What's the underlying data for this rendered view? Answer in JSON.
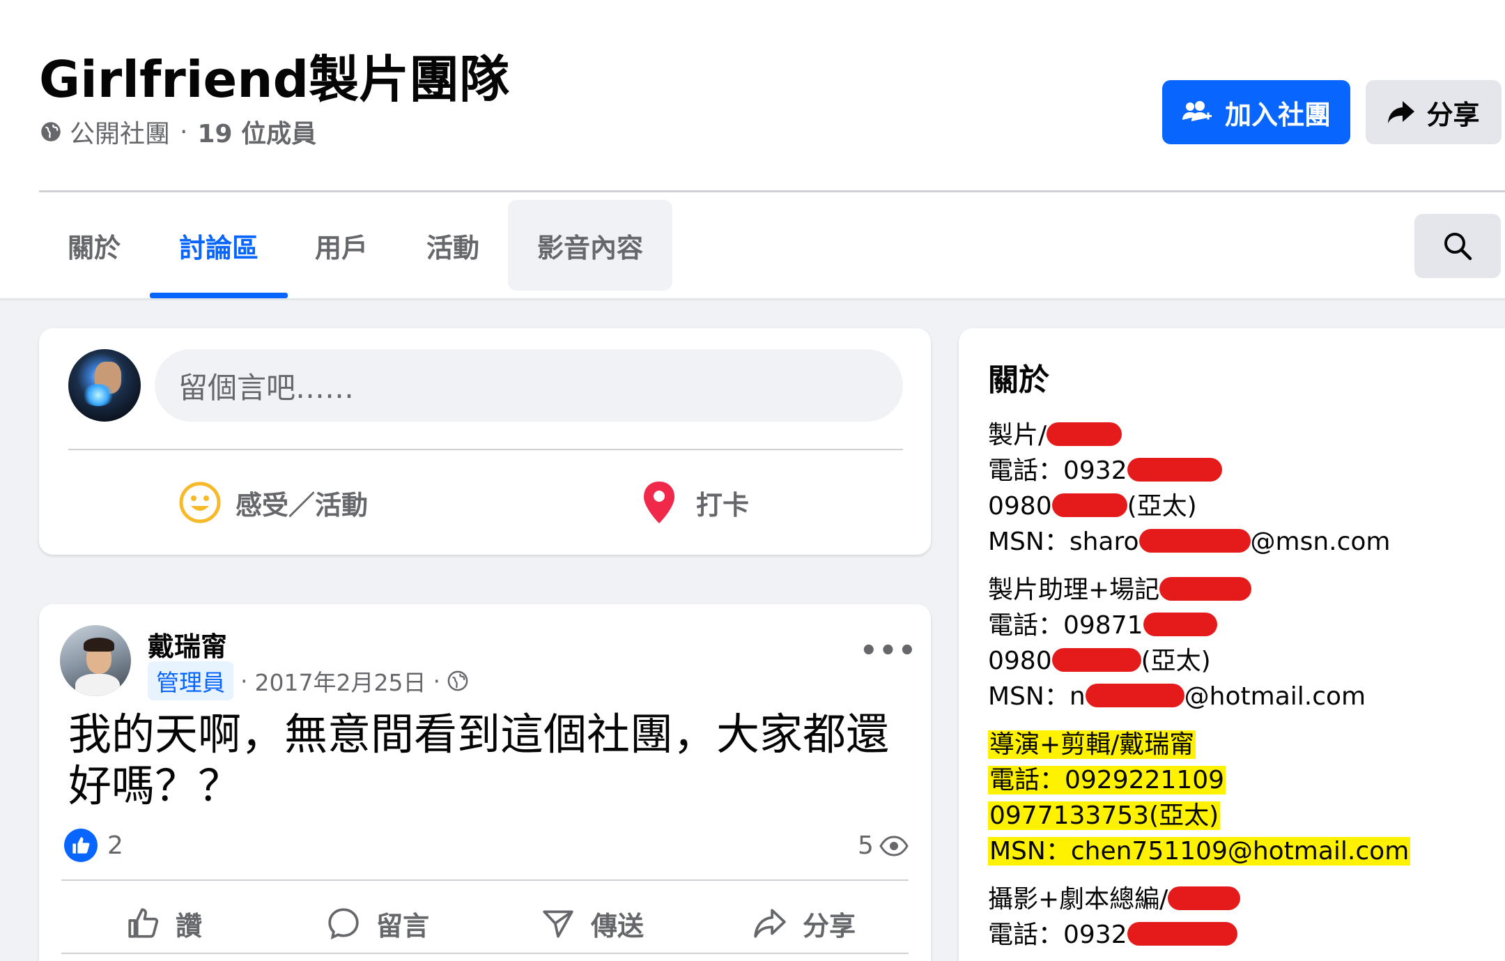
{
  "group": {
    "title": "Girlfriend製片團隊",
    "privacy": "公開社團",
    "separator": "·",
    "members": "19 位成員"
  },
  "header_buttons": {
    "join": "加入社團",
    "share": "分享"
  },
  "tabs": [
    {
      "label": "關於",
      "active": false
    },
    {
      "label": "討論區",
      "active": true
    },
    {
      "label": "用戶",
      "active": false
    },
    {
      "label": "活動",
      "active": false
    },
    {
      "label": "影音內容",
      "active": false
    }
  ],
  "composer": {
    "placeholder": "留個言吧……",
    "feeling": "感受／活動",
    "checkin": "打卡"
  },
  "post": {
    "author": "戴瑞甯",
    "badge": "管理員",
    "date": "2017年2月25日",
    "text": "我的天啊，無意間看到這個社團，大家都還好嗎？？",
    "likes": "2",
    "views": "5",
    "actions": {
      "like": "讚",
      "comment": "留言",
      "send": "傳送",
      "share": "分享"
    }
  },
  "about": {
    "title": "關於",
    "lines": {
      "l1": "製片/",
      "l2": "電話：0932",
      "l3a": "0980",
      "l3b": "(亞太)",
      "l4a": "MSN：sharo",
      "l4b": "@msn.com",
      "l5": "製片助理+場記",
      "l6": "電話：09871",
      "l7a": "0980",
      "l7b": "(亞太)",
      "l8a": "MSN：n",
      "l8b": "@hotmail.com",
      "l9": "導演+剪輯/戴瑞甯",
      "l10": "電話：0929221109",
      "l11": "0977133753(亞太)",
      "l12": "MSN：chen751109@hotmail.com",
      "l13": "攝影+劇本總編/",
      "l14": "電話：0932"
    }
  },
  "colors": {
    "accent": "#0866ff",
    "highlight": "#fff200",
    "redaction": "#e51b1b",
    "checkin_pin": "#f02849",
    "feeling_emoji": "#f7b928"
  },
  "icons": [
    "globe-icon",
    "add-people-icon",
    "share-arrow-icon",
    "search-icon",
    "smile-icon",
    "location-pin-icon",
    "more-icon",
    "thumbs-up-icon",
    "eye-icon",
    "comment-icon",
    "send-icon"
  ]
}
